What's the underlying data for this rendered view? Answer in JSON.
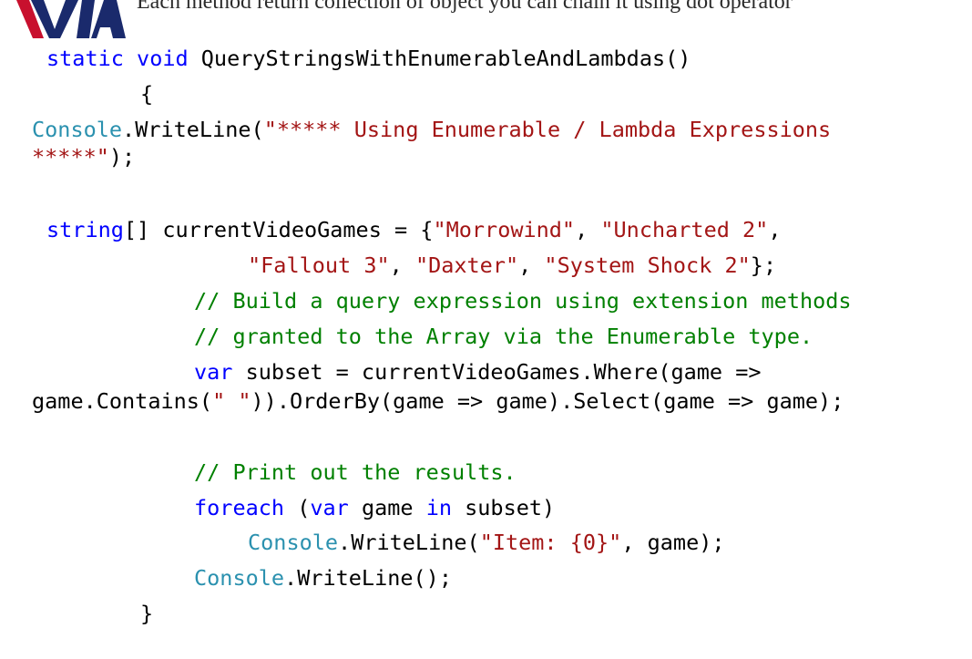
{
  "caption": "Each method return collection of object you can chain it using dot operator",
  "colors": {
    "keyword": "#0000ff",
    "type": "#2b91af",
    "string": "#a31515",
    "comment": "#008000",
    "plain": "#000000",
    "logo_red": "#c8102e",
    "logo_navy": "#1a2a6c"
  },
  "code": {
    "l1": {
      "kw_static": "static",
      "kw_void": "void",
      "method": " QueryStringsWithEnumerableAndLambdas()"
    },
    "l2": {
      "brace": "{"
    },
    "l3": {
      "type": "Console",
      "call": ".WriteLine(",
      "str": "\"***** Using Enumerable / Lambda Expressions"
    },
    "l4": {
      "str": "*****\"",
      "end": ");"
    },
    "l5": {
      "kw": "string",
      "decl": "[] currentVideoGames = {",
      "s1": "\"Morrowind\"",
      "sep1": ", ",
      "s2": "\"Uncharted 2\"",
      "sep2": ","
    },
    "l6": {
      "s3": "\"Fallout 3\"",
      "sep3": ", ",
      "s4": "\"Daxter\"",
      "sep4": ", ",
      "s5": "\"System Shock 2\"",
      "end": "};"
    },
    "l7": {
      "comment": "// Build a query expression using extension methods"
    },
    "l8": {
      "comment": "// granted to the Array via the Enumerable type."
    },
    "l9": {
      "kw": "var",
      "rest": " subset = currentVideoGames.Where(game =>"
    },
    "l10": {
      "pre": "game.Contains(",
      "str": "\" \"",
      "rest": ")).OrderBy(game => game).Select(game => game);"
    },
    "l11": {
      "comment": "// Print out the results."
    },
    "l12": {
      "kw_foreach": "foreach",
      "open": " (",
      "kw_var": "var",
      "mid": " game ",
      "kw_in": "in",
      "rest": " subset)"
    },
    "l13": {
      "type": "Console",
      "call": ".WriteLine(",
      "str": "\"Item: {0}\"",
      "rest": ", game);"
    },
    "l14": {
      "type": "Console",
      "call": ".WriteLine();"
    },
    "l15": {
      "brace": "}"
    }
  }
}
